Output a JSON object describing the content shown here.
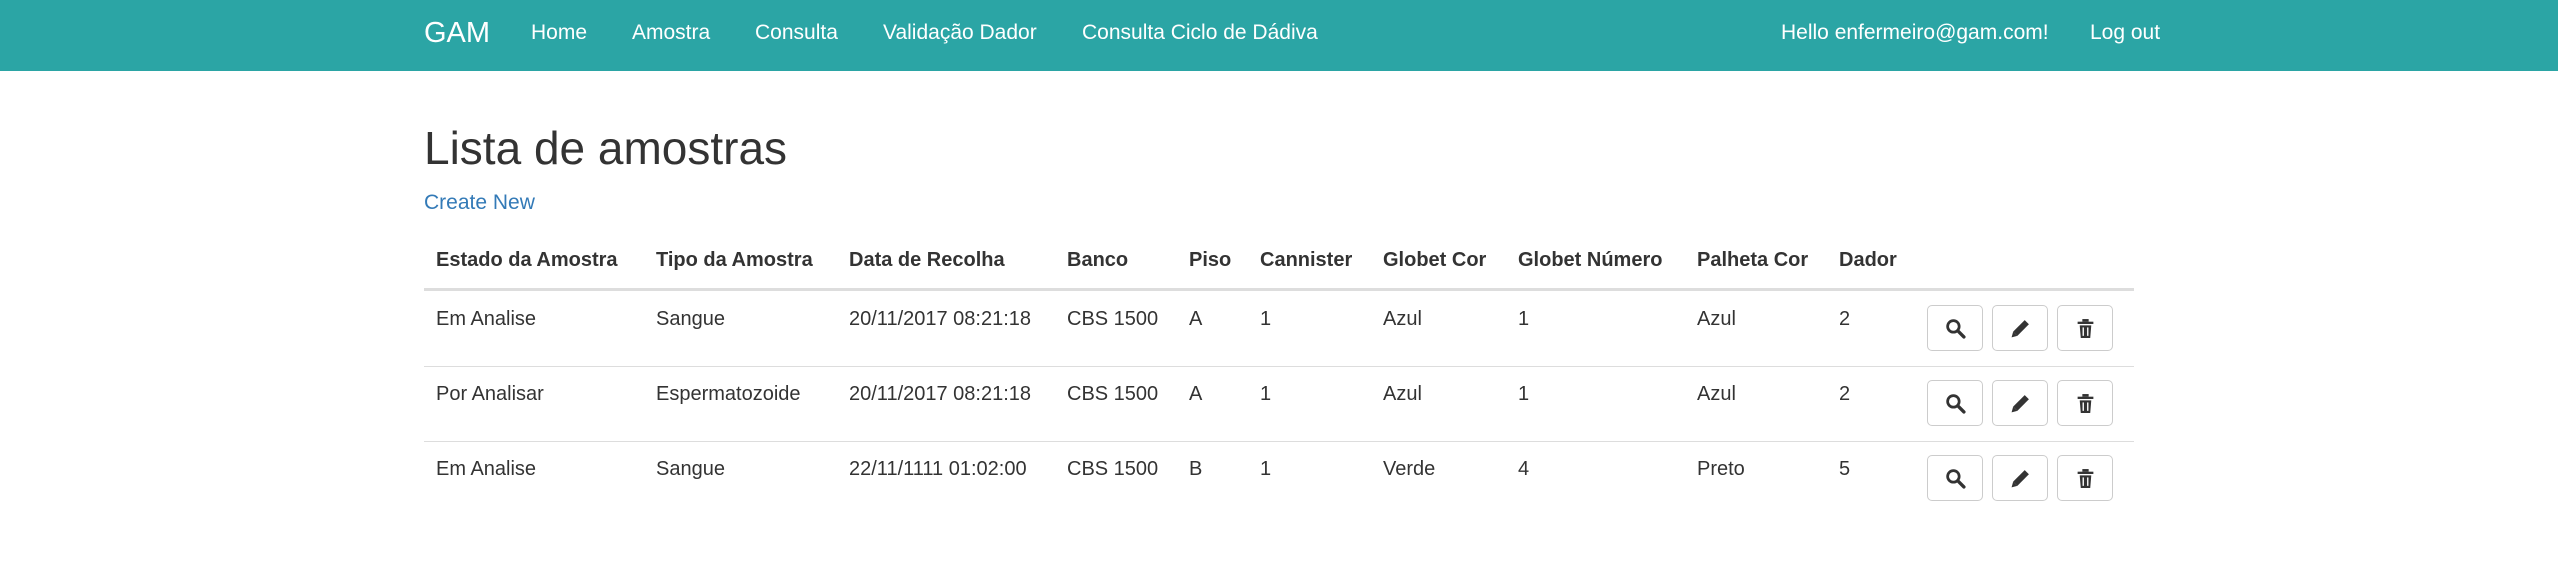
{
  "navbar": {
    "brand": "GAM",
    "links": [
      "Home",
      "Amostra",
      "Consulta",
      "Validação Dador",
      "Consulta Ciclo de Dádiva"
    ],
    "greeting": "Hello enfermeiro@gam.com!",
    "logout": "Log out",
    "color": "#2ba5a5"
  },
  "main": {
    "title": "Lista de amostras",
    "create_new": "Create New"
  },
  "table": {
    "headers": [
      "Estado da Amostra",
      "Tipo da Amostra",
      "Data de Recolha",
      "Banco",
      "Piso",
      "Cannister",
      "Globet Cor",
      "Globet Número",
      "Palheta Cor",
      "Dador"
    ],
    "rows": [
      [
        "Em Analise",
        "Sangue",
        "20/11/2017 08:21:18",
        "CBS 1500",
        "A",
        "1",
        "Azul",
        "1",
        "Azul",
        "2"
      ],
      [
        "Por Analisar",
        "Espermatozoide",
        "20/11/2017 08:21:18",
        "CBS 1500",
        "A",
        "1",
        "Azul",
        "1",
        "Azul",
        "2"
      ],
      [
        "Em Analise",
        "Sangue",
        "22/11/1111 01:02:00",
        "CBS 1500",
        "B",
        "1",
        "Verde",
        "4",
        "Preto",
        "5"
      ]
    ],
    "actions": [
      "search-icon",
      "pencil-icon",
      "trash-icon"
    ]
  }
}
